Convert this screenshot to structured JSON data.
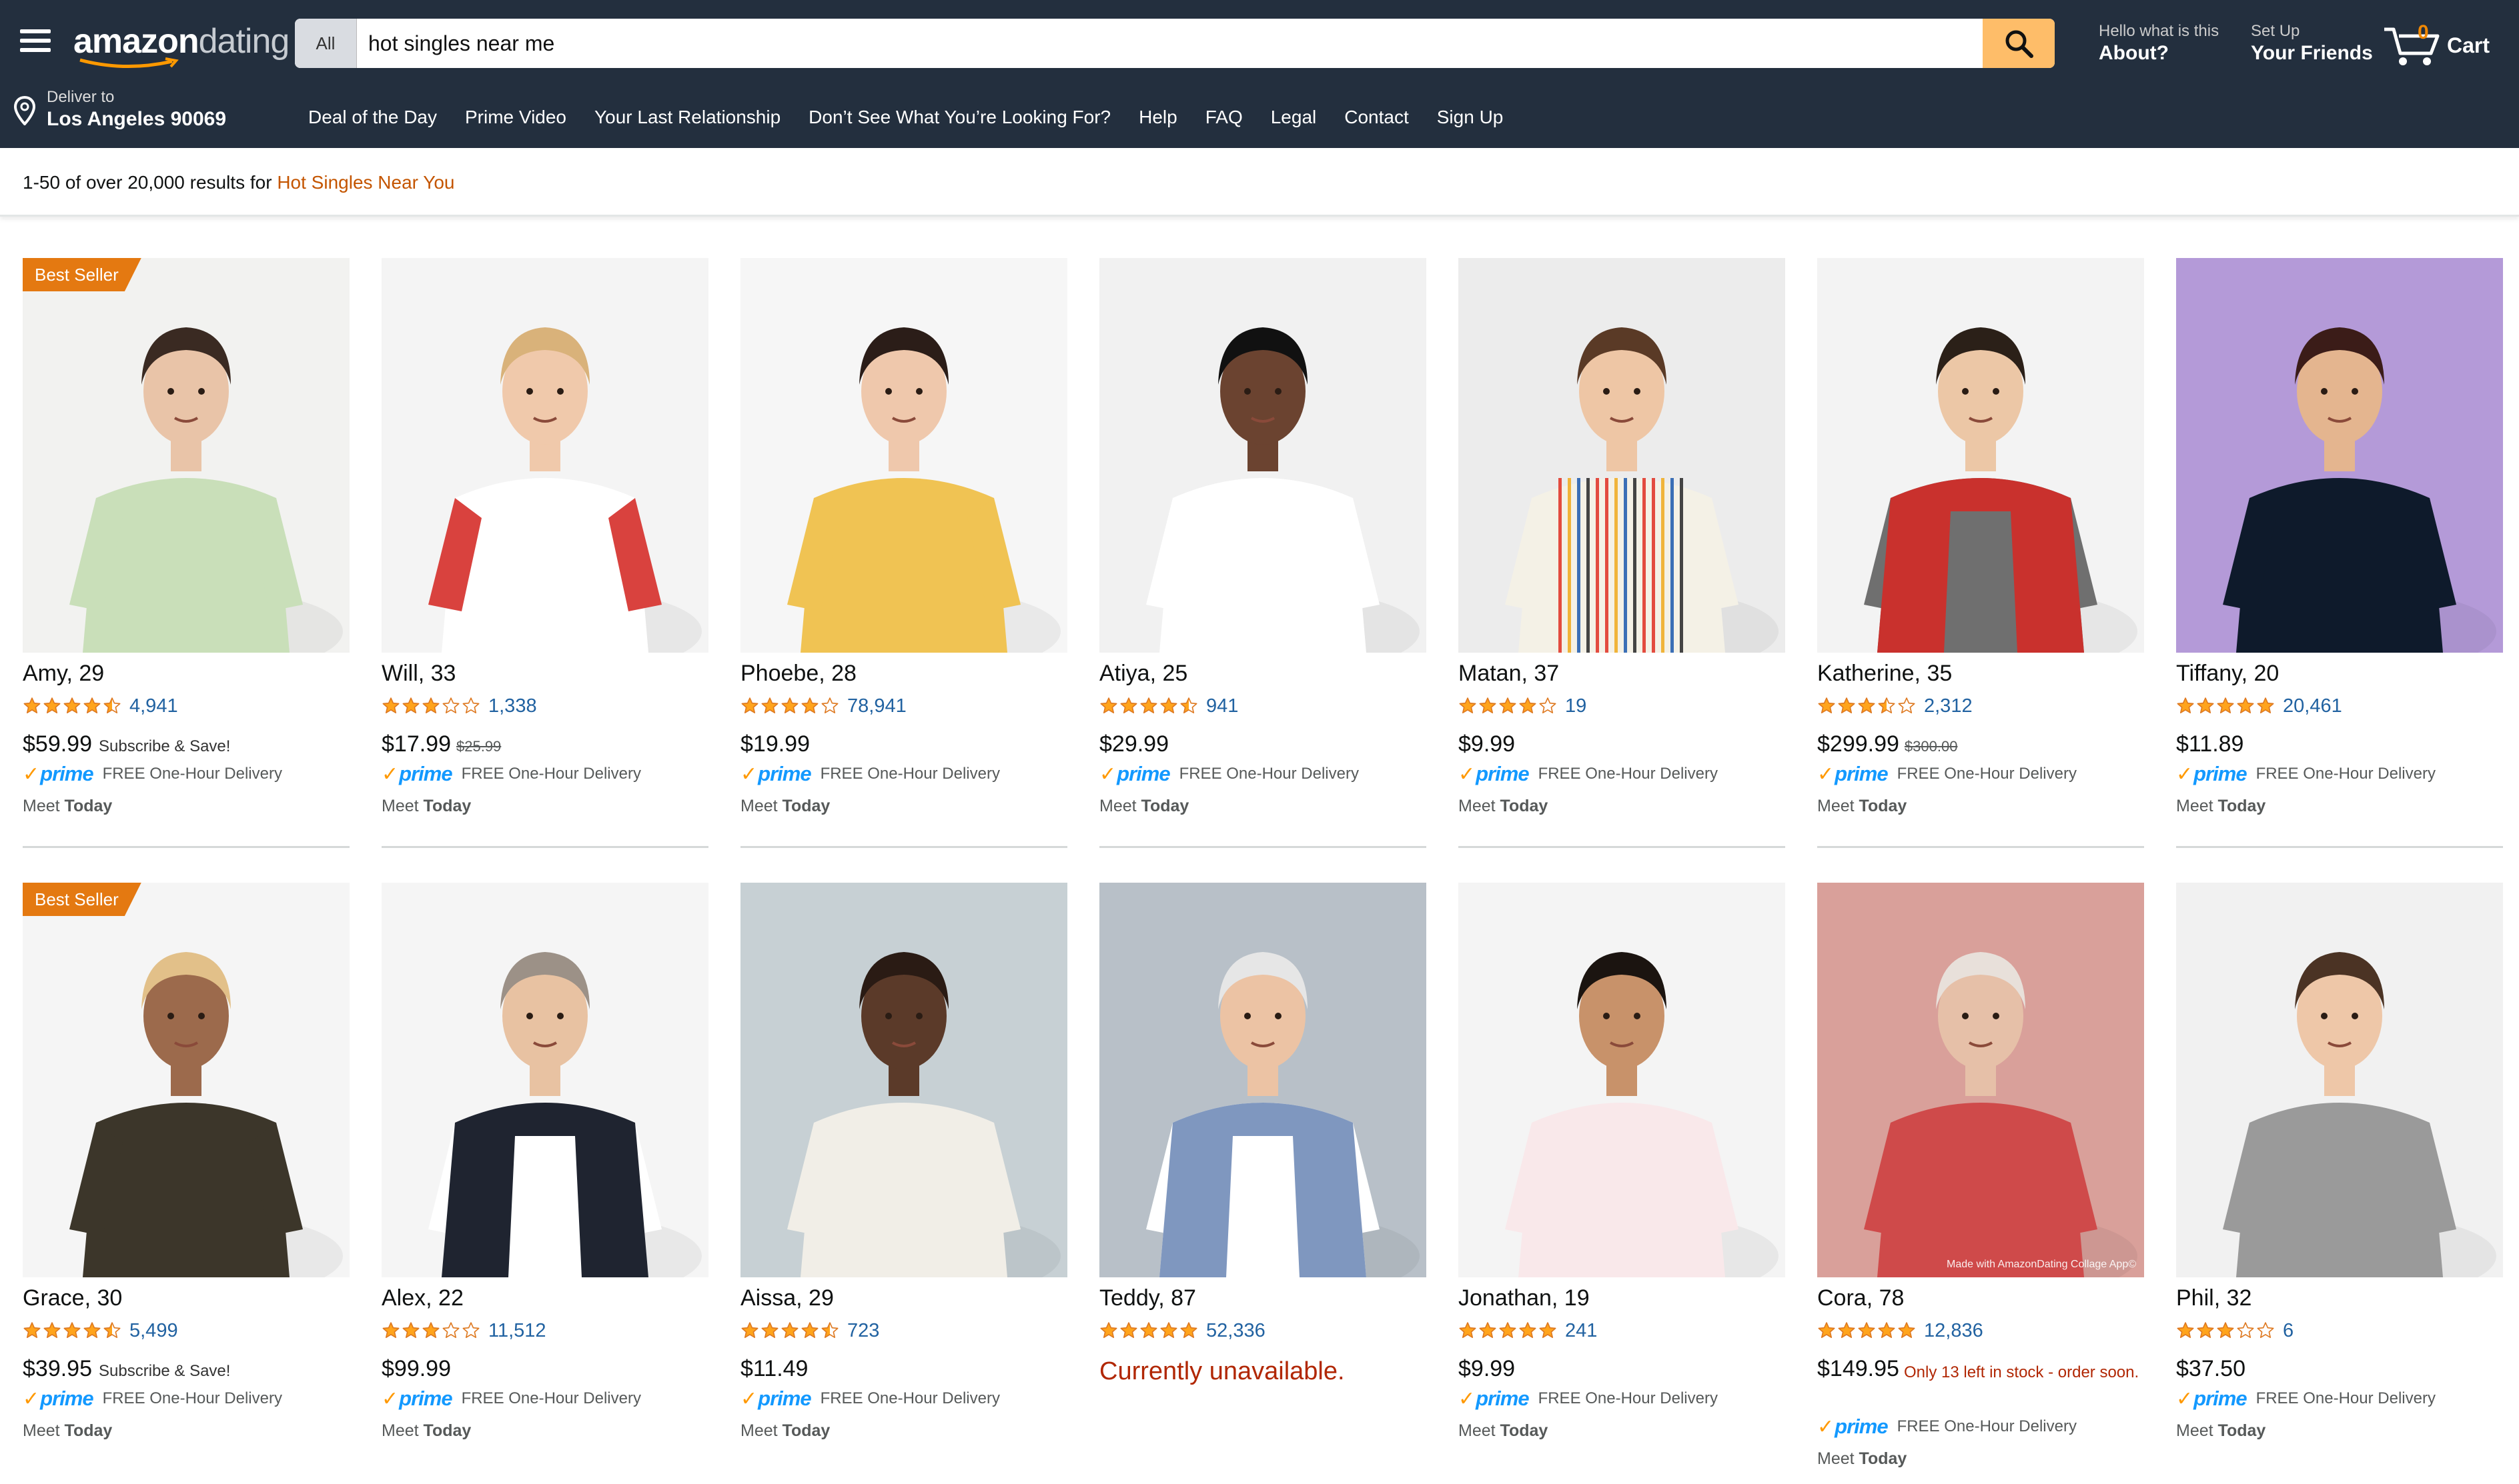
{
  "header": {
    "menu_icon": "hamburger-menu-icon",
    "logo_left": "amazon",
    "logo_right": "dating",
    "search": {
      "category": "All",
      "value": "hot singles near me",
      "icon": "search-icon"
    },
    "about": {
      "small": "Hello what is this",
      "big": "About?"
    },
    "friends": {
      "small": "Set Up",
      "big": "Your Friends"
    },
    "cart": {
      "count": "0",
      "label": "Cart",
      "icon": "cart-icon"
    },
    "deliver": {
      "small": "Deliver to",
      "big": "Los Angeles 90069",
      "icon": "location-pin-icon"
    },
    "nav_links": [
      "Deal of the Day",
      "Prime Video",
      "Your Last Relationship",
      "Don’t See What You’re Looking For?",
      "Help",
      "FAQ",
      "Legal",
      "Contact",
      "Sign Up"
    ]
  },
  "results": {
    "prefix": "1-50 of over 20,000 results for",
    "query": "Hot Singles Near You"
  },
  "colors": {
    "nav": "#232f3e",
    "search_button": "#febd69",
    "badge": "#e47911",
    "link": "#2162a1",
    "star": "#ffa41c",
    "prime": "#1399ff",
    "alert": "#b12704"
  },
  "products": [
    {
      "name": "Amy, 29",
      "badge": "Best Seller",
      "rating": 4.5,
      "reviews": "4,941",
      "price": "$59.99",
      "note": "Subscribe & Save!",
      "prime": true,
      "meet": "Meet",
      "meet_when": "Today"
    },
    {
      "name": "Will, 33",
      "rating": 3.0,
      "reviews": "1,338",
      "price": "$17.99",
      "old_price": "$25.99",
      "prime": true,
      "meet": "Meet",
      "meet_when": "Today"
    },
    {
      "name": "Phoebe, 28",
      "rating": 4.0,
      "reviews": "78,941",
      "price": "$19.99",
      "prime": true,
      "meet": "Meet",
      "meet_when": "Today"
    },
    {
      "name": "Atiya, 25",
      "rating": 4.5,
      "reviews": "941",
      "price": "$29.99",
      "prime": true,
      "meet": "Meet",
      "meet_when": "Today"
    },
    {
      "name": "Matan, 37",
      "rating": 4.0,
      "reviews": "19",
      "price": "$9.99",
      "prime": true,
      "meet": "Meet",
      "meet_when": "Today"
    },
    {
      "name": "Katherine, 35",
      "rating": 3.5,
      "reviews": "2,312",
      "price": "$299.99",
      "old_price": "$300.00",
      "prime": true,
      "meet": "Meet",
      "meet_when": "Today"
    },
    {
      "name": "Tiffany, 20",
      "rating": 5.0,
      "reviews": "20,461",
      "price": "$11.89",
      "prime": true,
      "meet": "Meet",
      "meet_when": "Today"
    },
    {
      "name": "Grace, 30",
      "badge": "Best Seller",
      "rating": 4.5,
      "reviews": "5,499",
      "price": "$39.95",
      "note": "Subscribe & Save!",
      "prime": true,
      "meet": "Meet",
      "meet_when": "Today"
    },
    {
      "name": "Alex, 22",
      "rating": 3.0,
      "reviews": "11,512",
      "price": "$99.99",
      "prime": true,
      "meet": "Meet",
      "meet_when": "Today"
    },
    {
      "name": "Aissa, 29",
      "rating": 4.5,
      "reviews": "723",
      "price": "$11.49",
      "prime": true,
      "meet": "Meet",
      "meet_when": "Today"
    },
    {
      "name": "Teddy, 87",
      "rating": 5.0,
      "reviews": "52,336",
      "unavailable": "Currently unavailable."
    },
    {
      "name": "Jonathan, 19",
      "rating": 5.0,
      "reviews": "241",
      "price": "$9.99",
      "prime": true,
      "meet": "Meet",
      "meet_when": "Today"
    },
    {
      "name": "Cora, 78",
      "rating": 5.0,
      "reviews": "12,836",
      "price": "$149.95",
      "stock_warning": "Only 13 left in stock - order soon.",
      "watermark": "Made with AmazonDating Collage App©",
      "prime": true,
      "meet": "Meet",
      "meet_when": "Today"
    },
    {
      "name": "Phil, 32",
      "rating": 3.0,
      "reviews": "6",
      "price": "$37.50",
      "prime": true,
      "meet": "Meet",
      "meet_when": "Today"
    }
  ],
  "prime_label": "prime",
  "prime_delivery": "FREE One-Hour Delivery"
}
